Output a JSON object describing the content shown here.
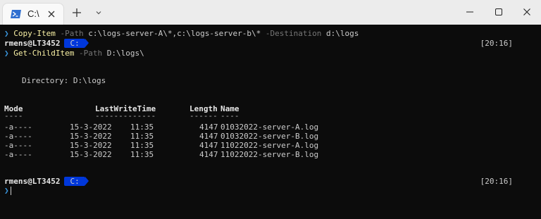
{
  "tab": {
    "title": "C:\\",
    "icon": "powershell-icon"
  },
  "window_controls": [
    "minimize-icon",
    "maximize-icon",
    "close-icon"
  ],
  "terminal": {
    "command1": {
      "cmdlet": "Copy-Item",
      "param1": "-Path",
      "arg1": "c:\\logs-server-A\\*,c:\\logs-server-b\\*",
      "param2": "-Destination",
      "arg2": "d:\\logs"
    },
    "prompt1": {
      "user": "rmens@LT3452",
      "path": "C:",
      "time": "[20:16]"
    },
    "command2": {
      "cmdlet": "Get-ChildItem",
      "param1": "-Path",
      "arg1": "D:\\logs\\"
    },
    "directory_line": "Directory: D:\\logs",
    "table": {
      "headers": {
        "mode": "Mode",
        "lastwrite": "LastWriteTime",
        "length": "Length",
        "name": "Name"
      },
      "dashes": {
        "mode": "----",
        "lastwrite": "-------------",
        "length": "------",
        "name": "----"
      },
      "rows": [
        {
          "mode": "-a----",
          "date": "15-3-2022",
          "time": "11:35",
          "length": "4147",
          "name": "01032022-server-A.log"
        },
        {
          "mode": "-a----",
          "date": "15-3-2022",
          "time": "11:35",
          "length": "4147",
          "name": "01032022-server-B.log"
        },
        {
          "mode": "-a----",
          "date": "15-3-2022",
          "time": "11:35",
          "length": "4147",
          "name": "11022022-server-A.log"
        },
        {
          "mode": "-a----",
          "date": "15-3-2022",
          "time": "11:35",
          "length": "4147",
          "name": "11022022-server-B.log"
        }
      ]
    },
    "prompt2": {
      "user": "rmens@LT3452",
      "path": "C:",
      "time": "[20:16]"
    },
    "chevron": "❯"
  },
  "colors": {
    "background": "#0c0c0c",
    "cmdlet": "#f9f1a5",
    "parameter": "#767676",
    "badge": "#0037da",
    "chevron": "#3a96dd"
  }
}
